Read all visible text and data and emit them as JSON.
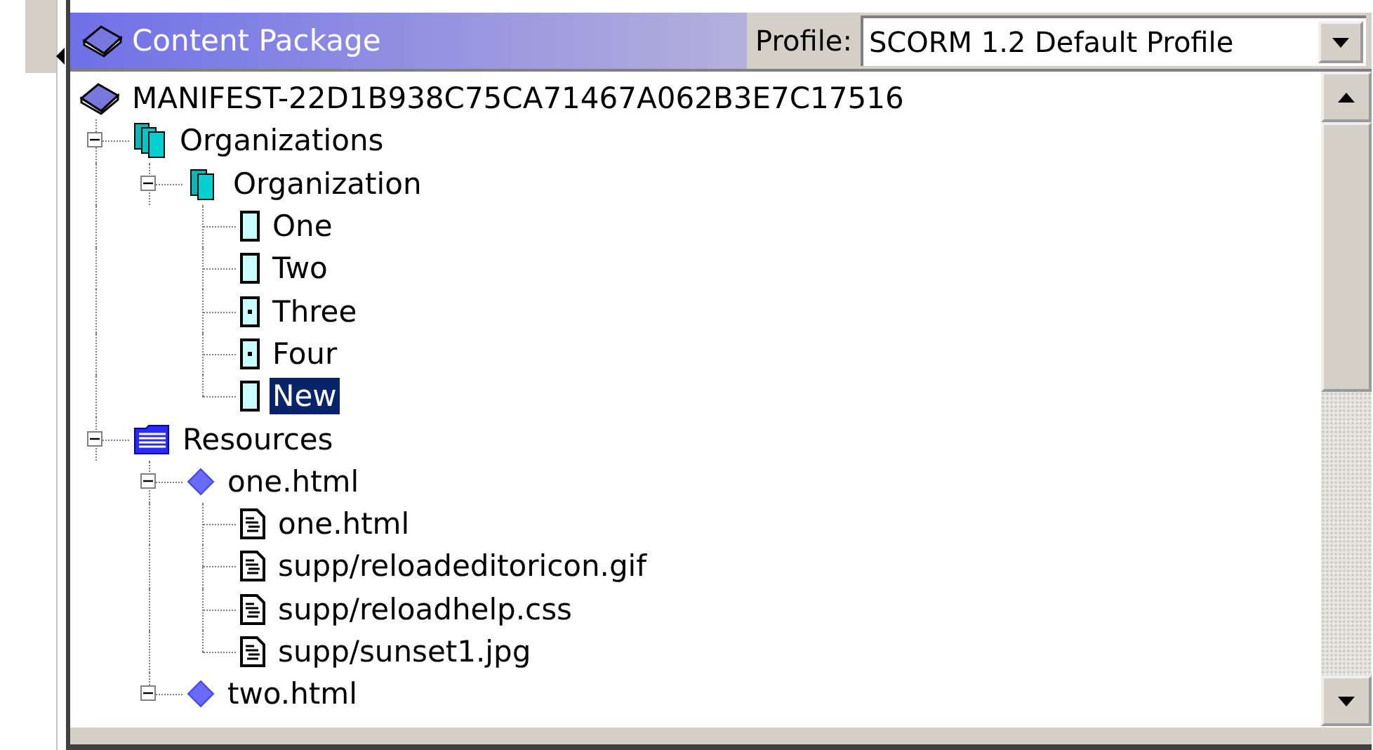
{
  "panel": {
    "title": "Content Package"
  },
  "profile": {
    "label": "Profile:",
    "value": "SCORM 1.2 Default Profile"
  },
  "tree": [
    {
      "label": "MANIFEST-22D1B938C75CA71467A062B3E7C17516",
      "kind": "manifest",
      "selected": false,
      "children": [
        {
          "label": "Organizations",
          "kind": "organizations",
          "expanded": true,
          "selected": false,
          "children": [
            {
              "label": "Organization",
              "kind": "organization",
              "expanded": true,
              "selected": false,
              "children": [
                {
                  "label": "One",
                  "kind": "item",
                  "linked": false,
                  "selected": false
                },
                {
                  "label": "Two",
                  "kind": "item",
                  "linked": false,
                  "selected": false
                },
                {
                  "label": "Three",
                  "kind": "item",
                  "linked": true,
                  "selected": false
                },
                {
                  "label": "Four",
                  "kind": "item",
                  "linked": true,
                  "selected": false
                },
                {
                  "label": "New",
                  "kind": "item",
                  "linked": false,
                  "selected": true
                }
              ]
            }
          ]
        },
        {
          "label": "Resources",
          "kind": "resources",
          "expanded": true,
          "selected": false,
          "children": [
            {
              "label": "one.html",
              "kind": "resource",
              "expanded": true,
              "selected": false,
              "children": [
                {
                  "label": "one.html",
                  "kind": "file",
                  "selected": false
                },
                {
                  "label": "supp/reloadeditoricon.gif",
                  "kind": "file",
                  "selected": false
                },
                {
                  "label": "supp/reloadhelp.css",
                  "kind": "file",
                  "selected": false
                },
                {
                  "label": "supp/sunset1.jpg",
                  "kind": "file",
                  "selected": false
                }
              ]
            },
            {
              "label": "two.html",
              "kind": "resource",
              "expanded": true,
              "selected": false
            }
          ]
        }
      ]
    }
  ]
}
